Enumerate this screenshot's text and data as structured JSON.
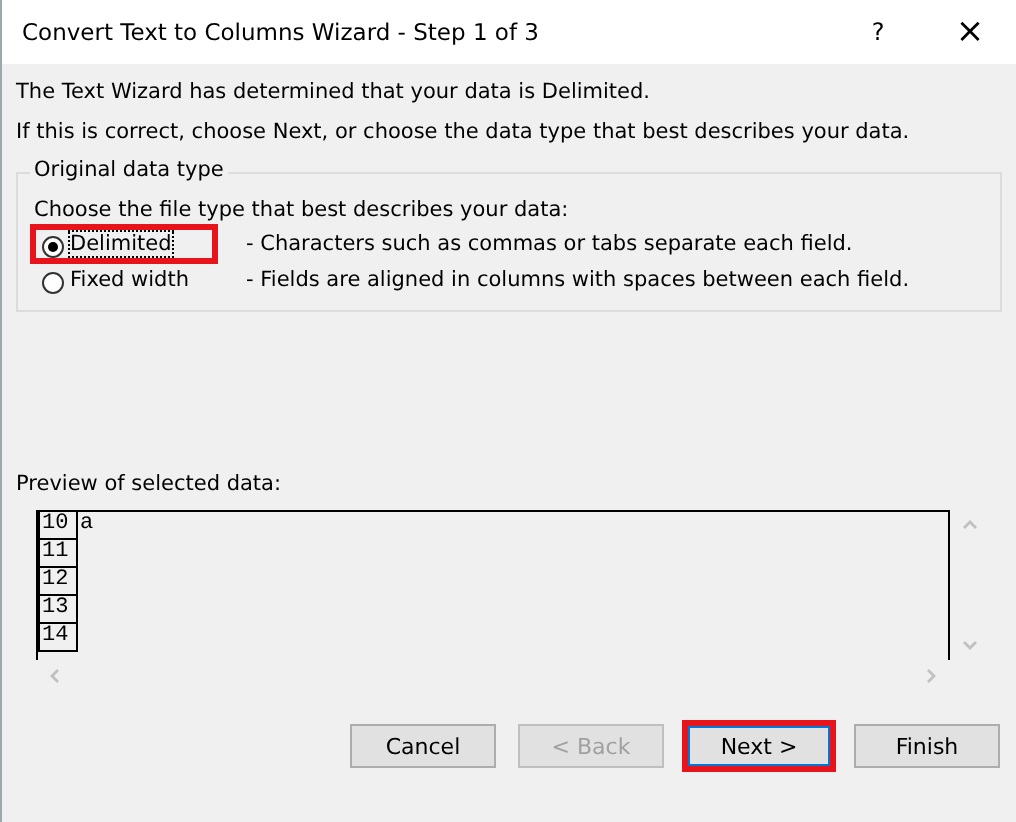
{
  "window": {
    "title": "Convert Text to Columns Wizard - Step 1 of 3",
    "help": "?",
    "close": "×"
  },
  "intro": [
    "The Text Wizard has determined that your data is Delimited.",
    "If this is correct, choose Next, or choose the data type that best describes your data."
  ],
  "group": {
    "title": "Original data type",
    "prompt": "Choose the file type that best describes your data:",
    "options": [
      {
        "label": "Delimited",
        "description": "- Characters such as commas or tabs separate each field.",
        "selected": true,
        "focused": true,
        "highlighted": true
      },
      {
        "label": "Fixed width",
        "description": "- Fields are aligned in columns with spaces between each field.",
        "selected": false,
        "focused": false,
        "highlighted": false
      }
    ]
  },
  "preview": {
    "label": "Preview of selected data:",
    "rows": [
      {
        "number": "10",
        "text": "a"
      },
      {
        "number": "11"
      },
      {
        "number": "12"
      },
      {
        "number": "13"
      },
      {
        "number": "14"
      }
    ]
  },
  "buttons": [
    {
      "label": "Cancel",
      "disabled": false,
      "default": false,
      "highlighted": false
    },
    {
      "label": "< Back",
      "disabled": true,
      "default": false,
      "highlighted": false
    },
    {
      "label": "Next >",
      "disabled": false,
      "default": true,
      "highlighted": true
    },
    {
      "label": "Finish",
      "disabled": false,
      "default": false,
      "highlighted": false
    }
  ]
}
